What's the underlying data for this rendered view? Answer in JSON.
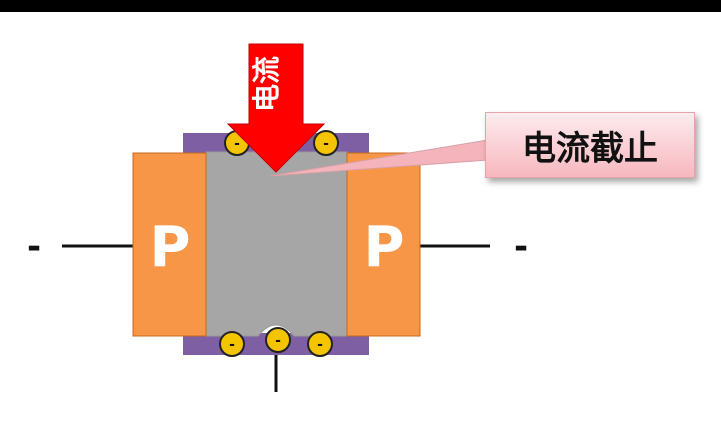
{
  "diagram": {
    "current_arrow_label": "电流",
    "left_region_label": "P",
    "right_region_label": "P",
    "left_terminal_sign": "-",
    "right_terminal_sign": "-",
    "carrier_sign": "-",
    "callout_text": "电流截止"
  },
  "colors": {
    "p_region": "#f79646",
    "channel": "#a6a6a6",
    "depletion": "#7f5fa3",
    "arrow": "#ff0000",
    "carrier": "#f5c400",
    "callout_bg": "#f8c1c7"
  }
}
